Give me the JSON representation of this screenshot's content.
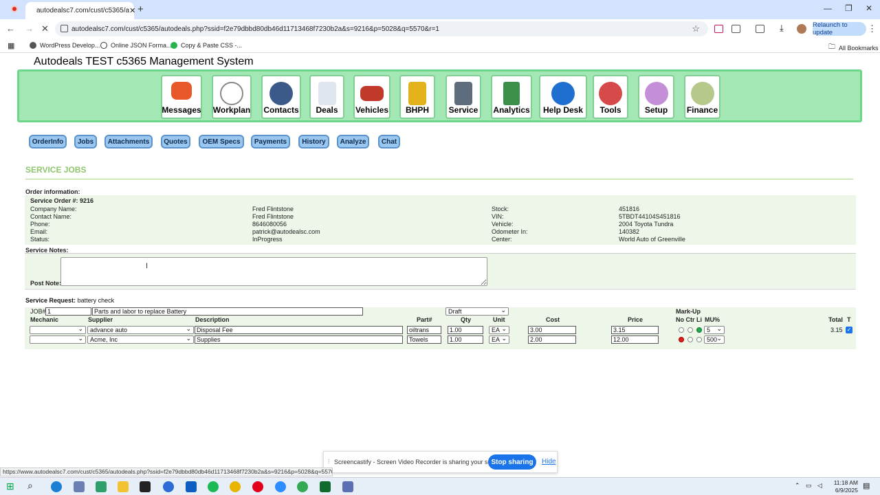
{
  "browser": {
    "tab_title": "autodealsc7.com/cust/c5365/a",
    "url": "autodealsc7.com/cust/c5365/autodeals.php?ssid=f2e79dbbd80db46d11713468f7230b2a&s=9216&p=5028&q=5570&r=1",
    "relaunch_label": "Relaunch to update",
    "bookmarks": [
      "WordPress Develop...",
      "Online JSON Forma...",
      "Copy & Paste CSS -..."
    ],
    "all_bookmarks_label": "All Bookmarks",
    "status_url": "https://www.autodealsc7.com/cust/c5365/autodeals.php?ssid=f2e79dbbd80db46d11713468f7230b2a&s=9216&p=5028&q=5570&r="
  },
  "app": {
    "title": "Autodeals TEST c5365 Management System",
    "menu": [
      "Messages",
      "Workplan",
      "Contacts",
      "Deals",
      "Vehicles",
      "BHPH",
      "Service",
      "Analytics",
      "Help Desk",
      "Tools",
      "Setup",
      "Finance"
    ],
    "subtabs": [
      "OrderInfo",
      "Jobs",
      "Attachments",
      "Quotes",
      "OEM Specs",
      "Payments",
      "History",
      "Analyze",
      "Chat"
    ]
  },
  "order": {
    "section_title": "SERVICE JOBS",
    "info_label": "Order information:",
    "order_no": "Service Order #: 9216",
    "left_labels": [
      "Company Name:",
      "Contact Name:",
      "Phone:",
      "Email:",
      "Status:"
    ],
    "left_values": [
      "Fred Flintstone",
      "Fred Flintstone",
      "8646080056",
      "patrick@autodealsc.com",
      "InProgress"
    ],
    "right_labels": [
      "Stock:",
      "VIN:",
      "Vehicle:",
      "Odometer In:",
      "Center:"
    ],
    "right_values": [
      "451816",
      "5TBDT44104S451816",
      "2004 Toyota Tundra",
      "140382",
      "World Auto of Greenville"
    ],
    "notes_label": "Service Notes:",
    "post_note_label": "Post Note:",
    "request_label": "Service Request:",
    "request_value": "battery check"
  },
  "job": {
    "job_label": "JOB#",
    "job_number": "1",
    "job_title": "Parts and labor to replace Battery",
    "status_select": "Draft",
    "markup_label": "Mark-Up",
    "headers": [
      "Mechanic",
      "Supplier",
      "Description",
      "Part#",
      "Qty",
      "Unit",
      "Cost",
      "Price",
      "No Ctr Li",
      "MU%",
      "Total",
      "T"
    ],
    "lines": [
      {
        "mechanic": "",
        "supplier": "advance auto",
        "description": "Disposal Fee",
        "part": "oiltrans",
        "qty": "1.00",
        "unit": "EA",
        "cost": "3.00",
        "price": "3.15",
        "mu": "5",
        "total": "3.15"
      },
      {
        "mechanic": "",
        "supplier": "Acme, Inc",
        "description": "Supplies",
        "part": "Towels",
        "qty": "1.00",
        "unit": "EA",
        "cost": "2.00",
        "price": "12.00",
        "mu": "500",
        "total": ""
      }
    ]
  },
  "share": {
    "message": "Screencastify - Screen Video Recorder is sharing your screen.",
    "stop_label": "Stop sharing",
    "hide_label": "Hide"
  },
  "taskbar": {
    "time": "11:18 AM",
    "date": "6/9/2025"
  }
}
